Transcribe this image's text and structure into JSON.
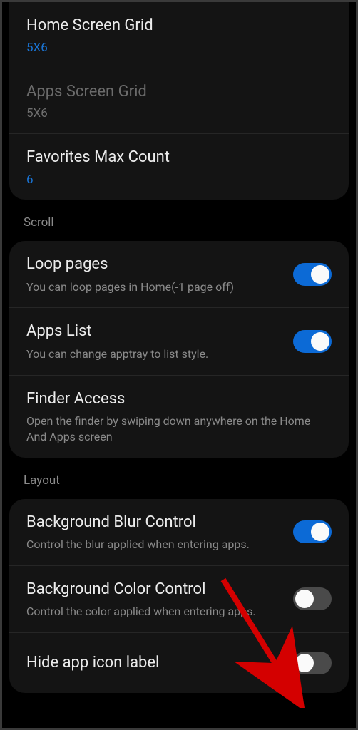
{
  "grid_section": {
    "items": [
      {
        "title": "Home Screen Grid",
        "value": "5X6",
        "enabled": true
      },
      {
        "title": "Apps Screen Grid",
        "value": "5X6",
        "enabled": false
      },
      {
        "title": "Favorites Max Count",
        "value": "6",
        "enabled": true
      }
    ]
  },
  "scroll_section": {
    "header": "Scroll",
    "items": [
      {
        "title": "Loop pages",
        "subtitle": "You can loop pages in Home(-1 page off)",
        "toggle": true
      },
      {
        "title": "Apps List",
        "subtitle": "You can change apptray to list style.",
        "toggle": true
      },
      {
        "title": "Finder Access",
        "subtitle": "Open the finder by swiping down anywhere on the Home And Apps screen",
        "toggle": null
      }
    ]
  },
  "layout_section": {
    "header": "Layout",
    "items": [
      {
        "title": "Background Blur Control",
        "subtitle": "Control the blur applied when entering apps.",
        "toggle": true
      },
      {
        "title": "Background Color Control",
        "subtitle": "Control the color applied when entering apps.",
        "toggle": false
      },
      {
        "title": "Hide app icon label",
        "subtitle": "",
        "toggle": false
      }
    ]
  }
}
